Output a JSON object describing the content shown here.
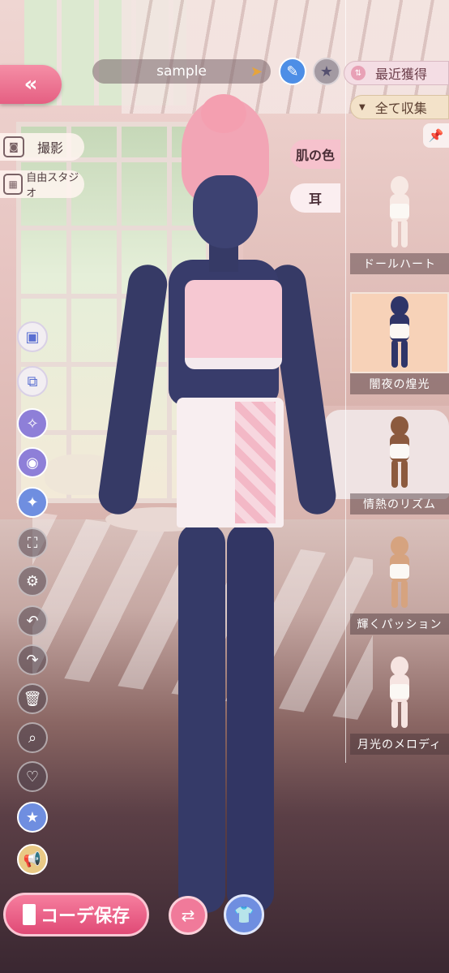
{
  "header": {
    "back_label": "«",
    "coord_name": "sample",
    "name_arrow": "➤",
    "edit_icon": "pencil-icon",
    "star_icon": "star-icon"
  },
  "filters": {
    "sort_label": "最近獲得",
    "collection_label": "全て収集"
  },
  "left_menu": {
    "photo_label": "撮影",
    "studio_label": "自由スタジオ"
  },
  "categories": {
    "skin_label": "肌の色",
    "ear_label": "耳"
  },
  "skin_tones": [
    {
      "label": "ドールハート",
      "selected": false,
      "color": "#f7e9e4"
    },
    {
      "label": "闇夜の煌光",
      "selected": true,
      "color": "#2f3568"
    },
    {
      "label": "情熱のリズム",
      "selected": false,
      "color": "#8c5a3e"
    },
    {
      "label": "輝くパッション",
      "selected": false,
      "color": "#d6a37f"
    },
    {
      "label": "月光のメロディ",
      "selected": false,
      "color": "#f6e4e1"
    }
  ],
  "tools": [
    {
      "name": "wardrobe-icon",
      "glyph": "▣",
      "style": "light"
    },
    {
      "name": "layer-icon",
      "glyph": "⧉",
      "style": "light"
    },
    {
      "name": "magic-search-icon",
      "glyph": "✧",
      "style": "purple"
    },
    {
      "name": "palette-icon",
      "glyph": "◉",
      "style": "purple"
    },
    {
      "name": "sparkle-star-icon",
      "glyph": "✦",
      "style": "blue"
    },
    {
      "name": "fullscreen-icon",
      "glyph": "⛶",
      "style": "dark"
    },
    {
      "name": "gear-icon",
      "glyph": "⚙",
      "style": "dark"
    },
    {
      "name": "undo-icon",
      "glyph": "↶",
      "style": "dark"
    },
    {
      "name": "redo-icon",
      "glyph": "↷",
      "style": "dark"
    },
    {
      "name": "trash-icon",
      "glyph": "🗑",
      "style": "dark"
    },
    {
      "name": "search-icon",
      "glyph": "⌕",
      "style": "dark"
    },
    {
      "name": "heart-icon",
      "glyph": "♡",
      "style": "dark"
    },
    {
      "name": "star-badge-icon",
      "glyph": "★",
      "style": "blue"
    },
    {
      "name": "megaphone-icon",
      "glyph": "📢",
      "style": "gold"
    }
  ],
  "bottom": {
    "save_label": "コーデ保存",
    "swap_icon": "swap-icon",
    "outfit_icon": "outfit-icon"
  },
  "colors": {
    "accent_pink": "#e55f82",
    "accent_blue": "#4d8ee6",
    "selected_bg": "#f7d2b8"
  }
}
